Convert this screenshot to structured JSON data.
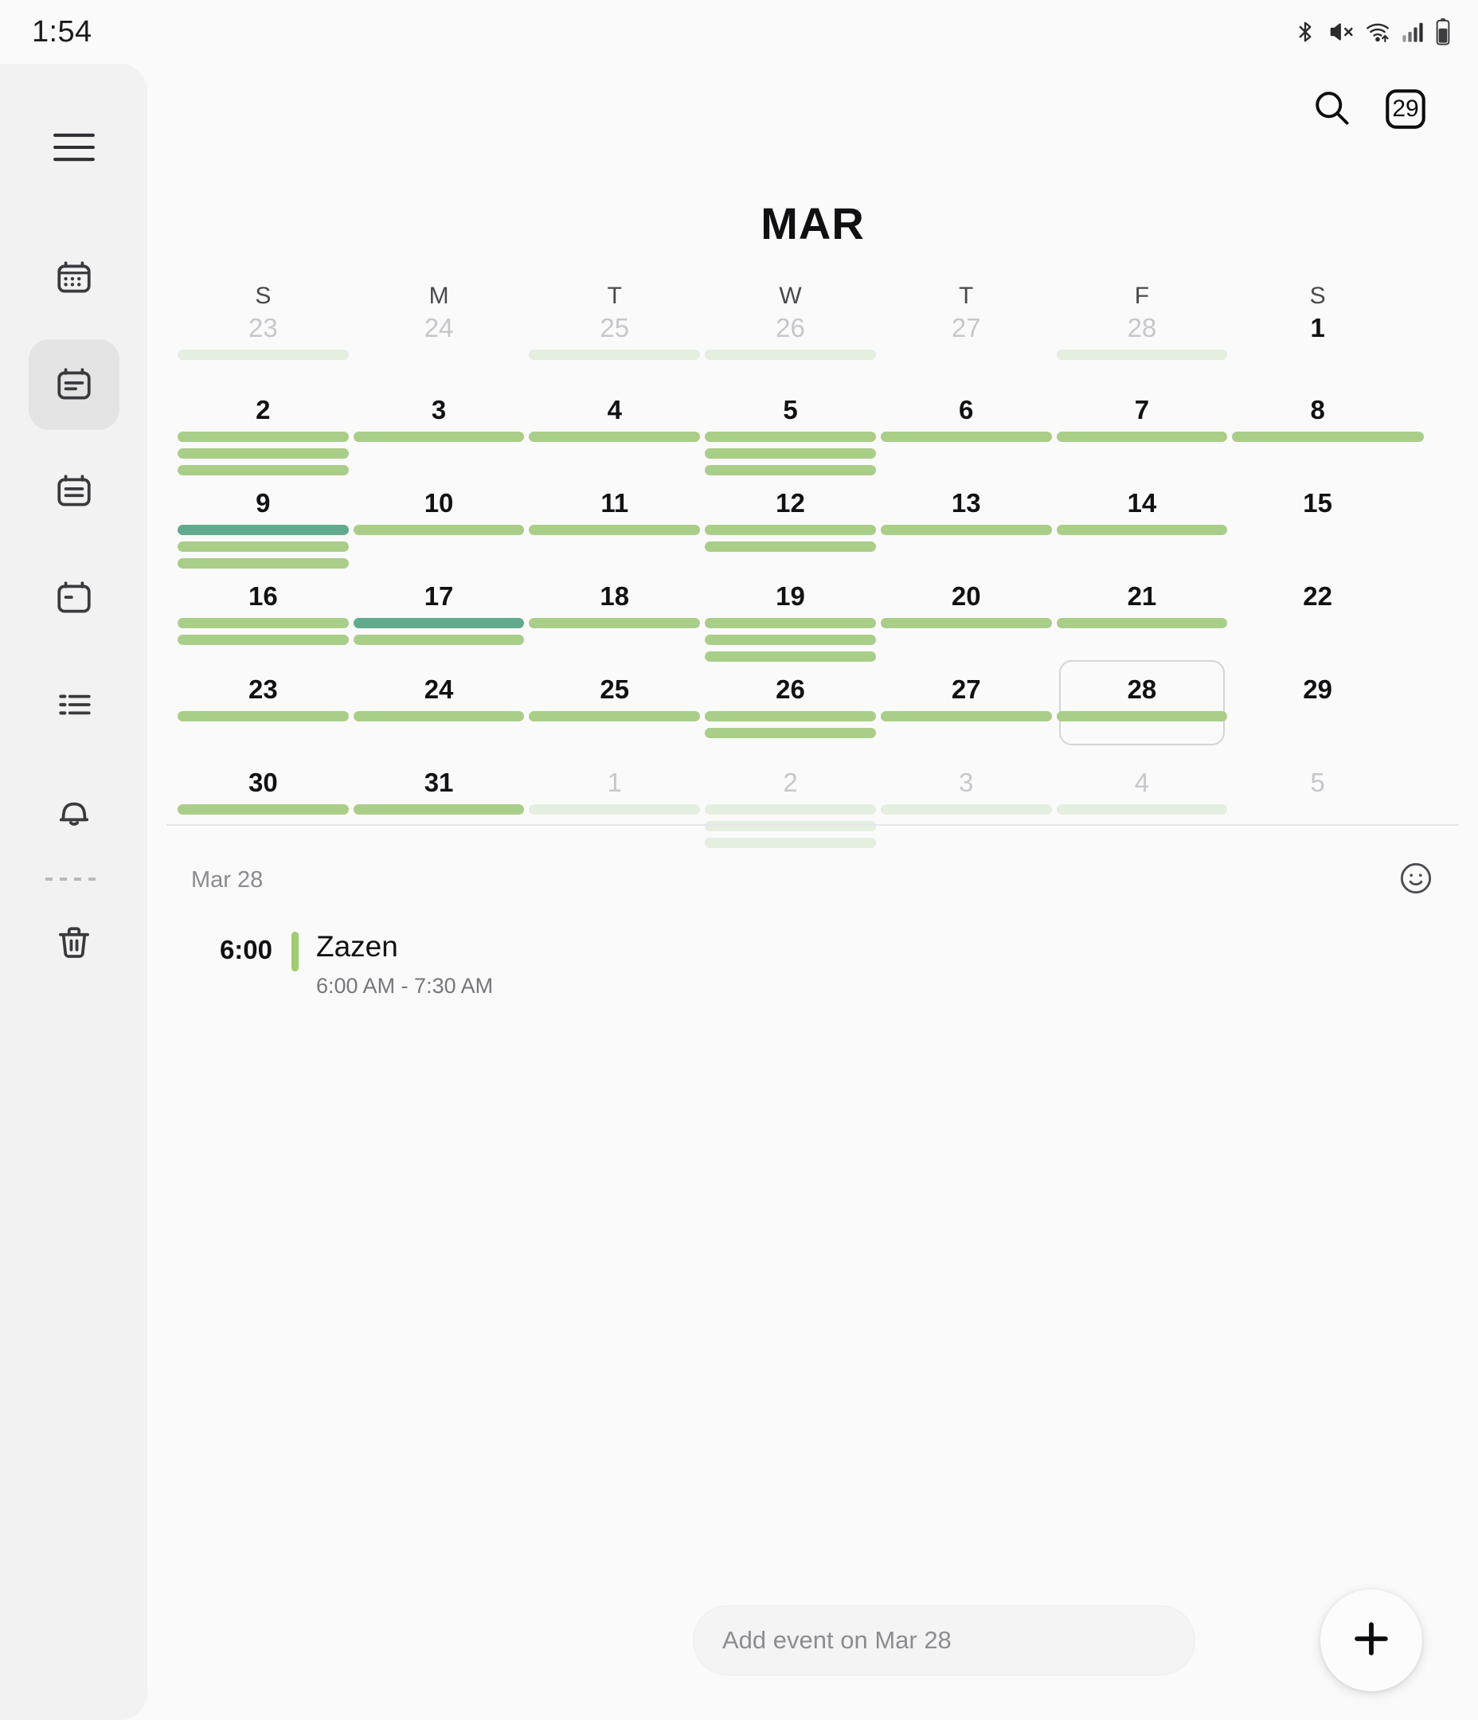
{
  "status_bar": {
    "time": "1:54",
    "icons": [
      "bluetooth-icon",
      "mute-icon",
      "wifi-icon",
      "cellular-signal-icon",
      "battery-icon"
    ]
  },
  "sidebar": {
    "items": [
      {
        "name": "hamburger-menu",
        "icon": "hamburger-icon",
        "selected": false
      },
      {
        "name": "month-view",
        "icon": "calendar-month-icon",
        "selected": false
      },
      {
        "name": "schedule-view",
        "icon": "calendar-schedule-icon",
        "selected": true
      },
      {
        "name": "week-view",
        "icon": "calendar-week-icon",
        "selected": false
      },
      {
        "name": "day-view",
        "icon": "calendar-day-icon",
        "selected": false
      },
      {
        "name": "agenda-list",
        "icon": "list-icon",
        "selected": false
      },
      {
        "name": "notifications",
        "icon": "bell-icon",
        "selected": false
      },
      {
        "name": "trash",
        "icon": "trash-icon",
        "selected": false
      }
    ]
  },
  "header": {
    "search_icon": "search-icon",
    "today_button_label": "29",
    "month_title": "MAR"
  },
  "calendar": {
    "day_headers": [
      "S",
      "M",
      "T",
      "W",
      "T",
      "F",
      "S"
    ],
    "selected_day": 28,
    "weeks": [
      [
        {
          "num": "23",
          "out": true,
          "bars": [
            "faded"
          ]
        },
        {
          "num": "24",
          "out": true,
          "bars": []
        },
        {
          "num": "25",
          "out": true,
          "bars": [
            "faded"
          ]
        },
        {
          "num": "26",
          "out": true,
          "bars": [
            "faded"
          ]
        },
        {
          "num": "27",
          "out": true,
          "bars": []
        },
        {
          "num": "28",
          "out": true,
          "bars": [
            "faded"
          ]
        },
        {
          "num": "1",
          "out": false,
          "bars": []
        }
      ],
      [
        {
          "num": "2",
          "out": false,
          "bars": [
            "green",
            "green",
            "green"
          ]
        },
        {
          "num": "3",
          "out": false,
          "bars": [
            "green"
          ]
        },
        {
          "num": "4",
          "out": false,
          "bars": [
            "green"
          ]
        },
        {
          "num": "5",
          "out": false,
          "bars": [
            "green",
            "green",
            "green"
          ]
        },
        {
          "num": "6",
          "out": false,
          "bars": [
            "green"
          ]
        },
        {
          "num": "7",
          "out": false,
          "bars": [
            "green"
          ]
        },
        {
          "num": "8",
          "out": false,
          "bars": [
            "green-wide"
          ]
        }
      ],
      [
        {
          "num": "9",
          "out": false,
          "bars": [
            "teal",
            "green",
            "green"
          ]
        },
        {
          "num": "10",
          "out": false,
          "bars": [
            "green"
          ]
        },
        {
          "num": "11",
          "out": false,
          "bars": [
            "green"
          ]
        },
        {
          "num": "12",
          "out": false,
          "bars": [
            "green",
            "green"
          ]
        },
        {
          "num": "13",
          "out": false,
          "bars": [
            "green"
          ]
        },
        {
          "num": "14",
          "out": false,
          "bars": [
            "green"
          ]
        },
        {
          "num": "15",
          "out": false,
          "bars": []
        }
      ],
      [
        {
          "num": "16",
          "out": false,
          "bars": [
            "green",
            "green"
          ]
        },
        {
          "num": "17",
          "out": false,
          "bars": [
            "teal",
            "green"
          ]
        },
        {
          "num": "18",
          "out": false,
          "bars": [
            "green"
          ]
        },
        {
          "num": "19",
          "out": false,
          "bars": [
            "green",
            "green",
            "green"
          ]
        },
        {
          "num": "20",
          "out": false,
          "bars": [
            "green"
          ]
        },
        {
          "num": "21",
          "out": false,
          "bars": [
            "green"
          ]
        },
        {
          "num": "22",
          "out": false,
          "bars": []
        }
      ],
      [
        {
          "num": "23",
          "out": false,
          "bars": [
            "green"
          ]
        },
        {
          "num": "24",
          "out": false,
          "bars": [
            "green"
          ]
        },
        {
          "num": "25",
          "out": false,
          "bars": [
            "green"
          ]
        },
        {
          "num": "26",
          "out": false,
          "bars": [
            "green",
            "green"
          ]
        },
        {
          "num": "27",
          "out": false,
          "bars": [
            "green"
          ]
        },
        {
          "num": "28",
          "out": false,
          "bars": [
            "green"
          ],
          "selected": true
        },
        {
          "num": "29",
          "out": false,
          "bars": []
        }
      ],
      [
        {
          "num": "30",
          "out": false,
          "bars": [
            "green"
          ]
        },
        {
          "num": "31",
          "out": false,
          "bars": [
            "green"
          ]
        },
        {
          "num": "1",
          "out": true,
          "bars": [
            "faded"
          ]
        },
        {
          "num": "2",
          "out": true,
          "bars": [
            "faded",
            "faded",
            "faded"
          ]
        },
        {
          "num": "3",
          "out": true,
          "bars": [
            "faded"
          ]
        },
        {
          "num": "4",
          "out": true,
          "bars": [
            "faded"
          ]
        },
        {
          "num": "5",
          "out": true,
          "bars": []
        }
      ]
    ]
  },
  "detail": {
    "date_label": "Mar 28",
    "mood_icon": "smiley-face-icon",
    "events": [
      {
        "time": "6:00",
        "title": "Zazen",
        "range": "6:00 AM - 7:30 AM",
        "color": "#A0CC6F"
      }
    ]
  },
  "bottom": {
    "add_placeholder": "Add event on Mar 28",
    "fab_icon": "plus-icon"
  },
  "colors": {
    "event_green": "#A9CE88",
    "event_teal": "#62AA8D",
    "event_faded": "#E4EFDF",
    "background": "#FAFAFB",
    "sidebar": "#F2F2F2"
  }
}
